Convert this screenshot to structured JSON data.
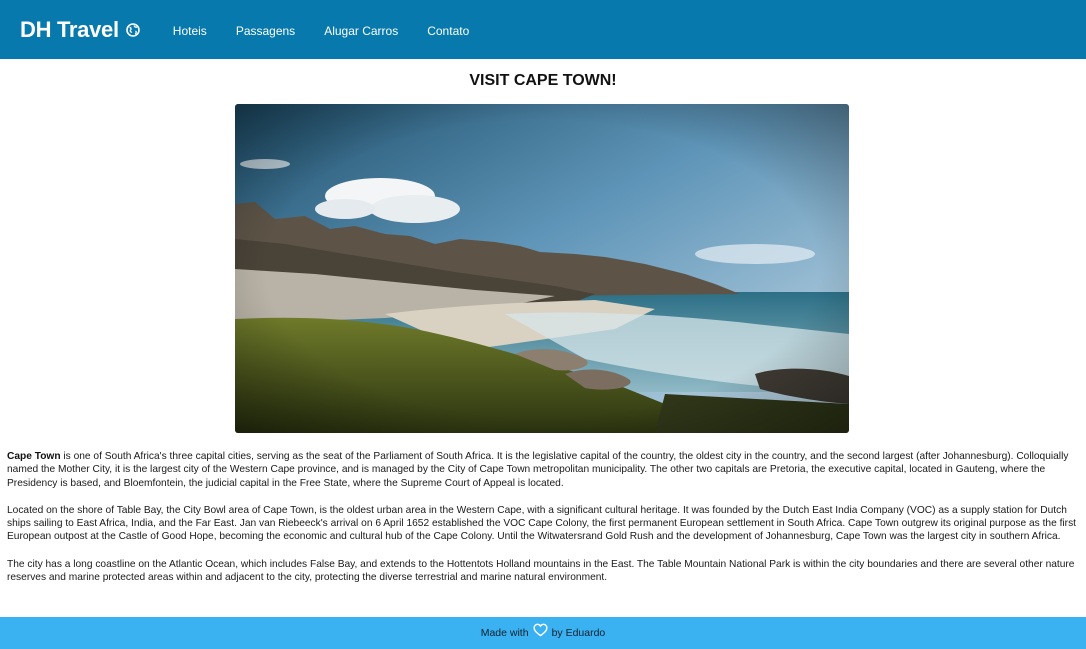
{
  "header": {
    "brand": "DH Travel",
    "brand_icon": "globe-icon",
    "nav": [
      "Hoteis",
      "Passagens",
      "Alugar Carros",
      "Contato"
    ]
  },
  "main": {
    "title": "VISIT CAPE TOWN!",
    "image_subject": "Cape Town coastline with mountains and beach",
    "paragraphs": [
      {
        "lead": "Cape Town",
        "text": " is one of South Africa's three capital cities, serving as the seat of the Parliament of South Africa. It is the legislative capital of the country, the oldest city in the country, and the second largest (after Johannesburg). Colloquially named the Mother City, it is the largest city of the Western Cape province, and is managed by the City of Cape Town metropolitan municipality. The other two capitals are Pretoria, the executive capital, located in Gauteng, where the Presidency is based, and Bloemfontein, the judicial capital in the Free State, where the Supreme Court of Appeal is located."
      },
      {
        "text": "Located on the shore of Table Bay, the City Bowl area of Cape Town, is the oldest urban area in the Western Cape, with a significant cultural heritage. It was founded by the Dutch East India Company (VOC) as a supply station for Dutch ships sailing to East Africa, India, and the Far East. Jan van Riebeeck's arrival on 6 April 1652 established the VOC Cape Colony, the first permanent European settlement in South Africa. Cape Town outgrew its original purpose as the first European outpost at the Castle of Good Hope, becoming the economic and cultural hub of the Cape Colony. Until the Witwatersrand Gold Rush and the development of Johannesburg, Cape Town was the largest city in southern Africa."
      },
      {
        "text": "The city has a long coastline on the Atlantic Ocean, which includes False Bay, and extends to the Hottentots Holland mountains in the East. The Table Mountain National Park is within the city boundaries and there are several other nature reserves and marine protected areas within and adjacent to the city, protecting the diverse terrestrial and marine natural environment."
      }
    ]
  },
  "footer": {
    "prefix": "Made with",
    "icon": "heart-icon",
    "suffix": "by Eduardo"
  },
  "colors": {
    "navbar": "#0779ad",
    "footer": "#3ab1f0"
  }
}
